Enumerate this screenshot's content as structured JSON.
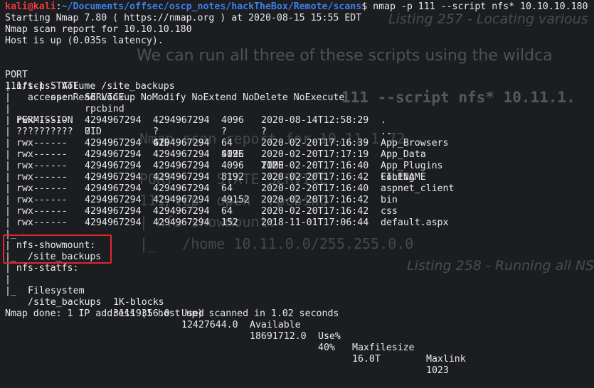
{
  "terminal": {
    "prompt": {
      "user": "kali@kali",
      "sep": ":",
      "path": "~/Documents/offsec/oscp_notes/hackTheBox/Remote/scans",
      "symbol": "$",
      "command": " nmap -p 111 --script nfs* 10.10.10.180"
    },
    "intro": [
      "Starting Nmap 7.80 ( https://nmap.org ) at 2020-08-15 15:55 EDT",
      "Nmap scan report for 10.10.10.180",
      "Host is up (0.035s latency)."
    ],
    "port_header": {
      "port": "PORT",
      "state": "STATE",
      "service": "SERVICE"
    },
    "port_row": {
      "port": "111/tcp",
      "state": "open",
      "service": "rpcbind"
    },
    "nfs_ls": {
      "title": "| nfs-ls: Volume /site_backups",
      "access": "|   access: Read Lookup NoModify NoExtend NoDelete NoExecute",
      "columns": [
        "PERMISSION",
        "UID",
        "GID",
        "SIZE",
        "TIME",
        "FILENAME"
      ],
      "rows": [
        [
          "rwx------",
          "4294967294",
          "4294967294",
          "4096",
          "2020-08-14T12:58:29",
          "."
        ],
        [
          "??????????",
          "?",
          "?",
          "?",
          "?",
          ".."
        ],
        [
          "rwx------",
          "4294967294",
          "4294967294",
          "64",
          "2020-02-20T17:16:39",
          "App_Browsers"
        ],
        [
          "rwx------",
          "4294967294",
          "4294967294",
          "4096",
          "2020-02-20T17:17:19",
          "App_Data"
        ],
        [
          "rwx------",
          "4294967294",
          "4294967294",
          "4096",
          "2020-02-20T17:16:40",
          "App_Plugins"
        ],
        [
          "rwx------",
          "4294967294",
          "4294967294",
          "8192",
          "2020-02-20T17:16:42",
          "Config"
        ],
        [
          "rwx------",
          "4294967294",
          "4294967294",
          "64",
          "2020-02-20T17:16:40",
          "aspnet_client"
        ],
        [
          "rwx------",
          "4294967294",
          "4294967294",
          "49152",
          "2020-02-20T17:16:42",
          "bin"
        ],
        [
          "rwx------",
          "4294967294",
          "4294967294",
          "64",
          "2020-02-20T17:16:42",
          "css"
        ],
        [
          "rwx------",
          "4294967294",
          "4294967294",
          "152",
          "2018-11-01T17:06:44",
          "default.aspx"
        ]
      ],
      "end": "|_"
    },
    "showmount": {
      "title": "| nfs-showmount:",
      "entry": "|_  /site_backups"
    },
    "statfs": {
      "title": "| nfs-statfs:",
      "columns": [
        "Filesystem",
        "1K-blocks",
        "Used",
        "Available",
        "Use%",
        "Maxfilesize",
        "Maxlink"
      ],
      "row": [
        "/site_backups",
        "31119356.0",
        "12427644.0",
        "18691712.0",
        "40%",
        "16.0T",
        "1023"
      ],
      "row_prefix_first": "|   ",
      "row_prefix": "|_  "
    },
    "done": "Nmap done: 1 IP address (1 host up) scanned in 1.02 seconds"
  },
  "background_text": {
    "cap1": "Listing 257 - Locating various",
    "body1": "We can run all three of these scripts using the wildca",
    "code1": "111 --script nfs* 10.11.1.",
    "code2": "Nmap scan report for 10.11.1.72",
    "code3": "PORT     STATE SERVICE",
    "code4": "111/tcp  open  rpcbind",
    "code5": "| nfs-showmount:",
    "code6": "|_   /home 10.11.0.0/255.255.0.0",
    "cap2": "Listing 258 - Running all NS"
  },
  "colors": {
    "background": "#1b1d21",
    "text": "#e8e8e8",
    "user": "#ef3b3b",
    "path": "#3f7fe6",
    "highlight": "#e2262e"
  }
}
